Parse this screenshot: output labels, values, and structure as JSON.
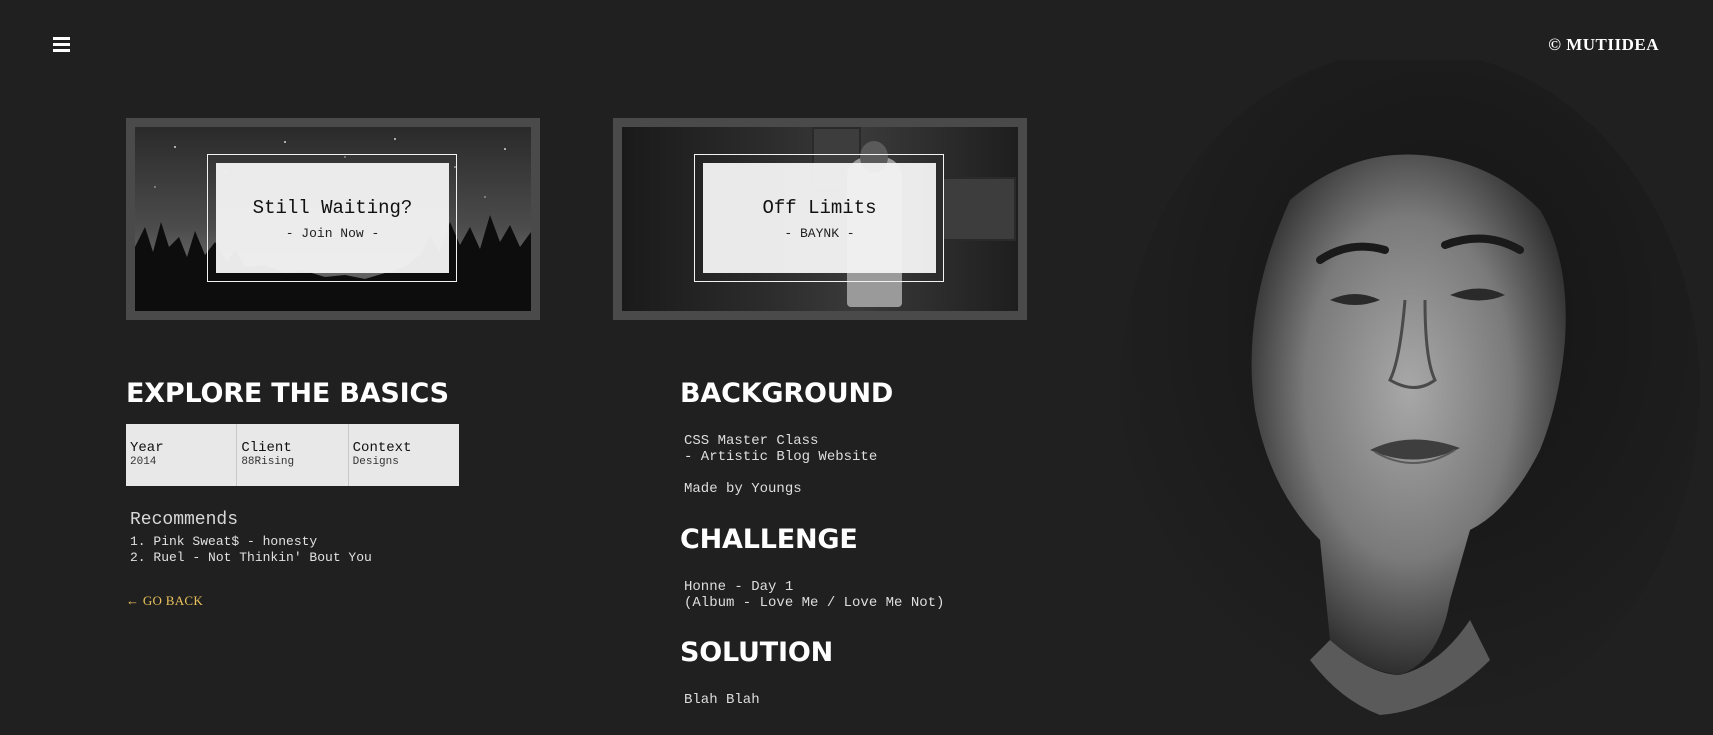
{
  "header": {
    "menu_icon": "hamburger-icon",
    "logo_text": "© MUTIIDEA"
  },
  "cards": [
    {
      "title": "Still Waiting?",
      "subtitle": "- Join Now -",
      "photo": "night-forest-sky"
    },
    {
      "title": "Off Limits",
      "subtitle": "- BAYNK -",
      "photo": "man-in-room"
    }
  ],
  "explore": {
    "title": "EXPLORE THE BASICS",
    "table": [
      {
        "key": "Year",
        "value": "2014"
      },
      {
        "key": "Client",
        "value": "88Rising"
      },
      {
        "key": "Context",
        "value": "Designs"
      }
    ],
    "recommends_title": "Recommends",
    "recommends": [
      "1. Pink Sweat$ - honesty",
      "2. Ruel - Not Thinkin' Bout You"
    ],
    "go_back": "← GO BACK"
  },
  "background": {
    "title": "BACKGROUND",
    "lines": [
      "CSS Master Class",
      "- Artistic Blog Website"
    ],
    "made_by": "Made by Youngs"
  },
  "challenge": {
    "title": "CHALLENGE",
    "lines": [
      "Honne - Day 1",
      "(Album - Love Me / Love Me Not)"
    ]
  },
  "solution": {
    "title": "SOLUTION",
    "lines": [
      "Blah Blah"
    ]
  },
  "colors": {
    "background": "#202020",
    "accent": "#e9c25c",
    "card_frame": "#4a4a4a",
    "label_bg": "#f2f2f2"
  }
}
